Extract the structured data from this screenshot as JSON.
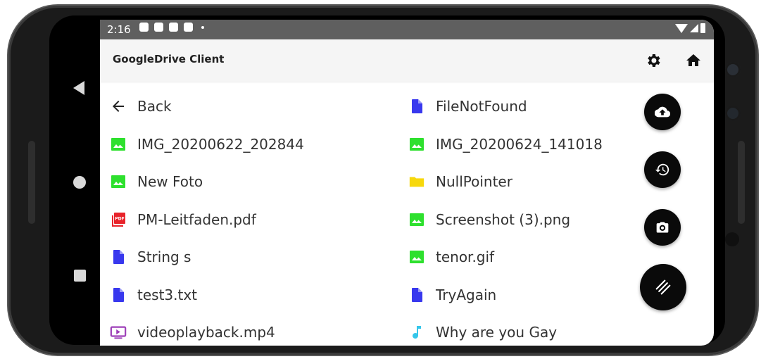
{
  "status_bar": {
    "time": "2:16"
  },
  "app_bar": {
    "title": "GoogleDrive Client"
  },
  "list": {
    "left": [
      {
        "label": "Back",
        "icon": "arrow-left-icon",
        "type": "back"
      },
      {
        "label": "IMG_20200622_202844",
        "icon": "image-icon",
        "type": "image"
      },
      {
        "label": "New Foto",
        "icon": "image-icon",
        "type": "image"
      },
      {
        "label": "PM-Leitfaden.pdf",
        "icon": "pdf-icon",
        "type": "pdf"
      },
      {
        "label": "String s",
        "icon": "file-icon",
        "type": "file"
      },
      {
        "label": "test3.txt",
        "icon": "file-icon",
        "type": "file"
      },
      {
        "label": "videoplayback.mp4",
        "icon": "video-icon",
        "type": "video"
      }
    ],
    "right": [
      {
        "label": "FileNotFound",
        "icon": "file-icon",
        "type": "file"
      },
      {
        "label": "IMG_20200624_141018",
        "icon": "image-icon",
        "type": "image"
      },
      {
        "label": "NullPointer",
        "icon": "folder-icon",
        "type": "folder"
      },
      {
        "label": "Screenshot (3).png",
        "icon": "image-icon",
        "type": "image"
      },
      {
        "label": "tenor.gif",
        "icon": "image-icon",
        "type": "image"
      },
      {
        "label": "TryAgain",
        "icon": "file-icon",
        "type": "file"
      },
      {
        "label": "Why are you Gay",
        "icon": "music-note-icon",
        "type": "audio"
      }
    ]
  },
  "fabs": [
    {
      "icon": "cloud-upload-icon"
    },
    {
      "icon": "history-icon"
    },
    {
      "icon": "camera-icon"
    },
    {
      "icon": "stripes-menu-icon"
    }
  ],
  "colors": {
    "image": "#2ee02e",
    "file": "#3838ee",
    "folder": "#f7d80c",
    "pdf": "#e8232a",
    "video": "#9d3fb8",
    "audio": "#35c6ea",
    "fab": "#0a0a0a"
  }
}
